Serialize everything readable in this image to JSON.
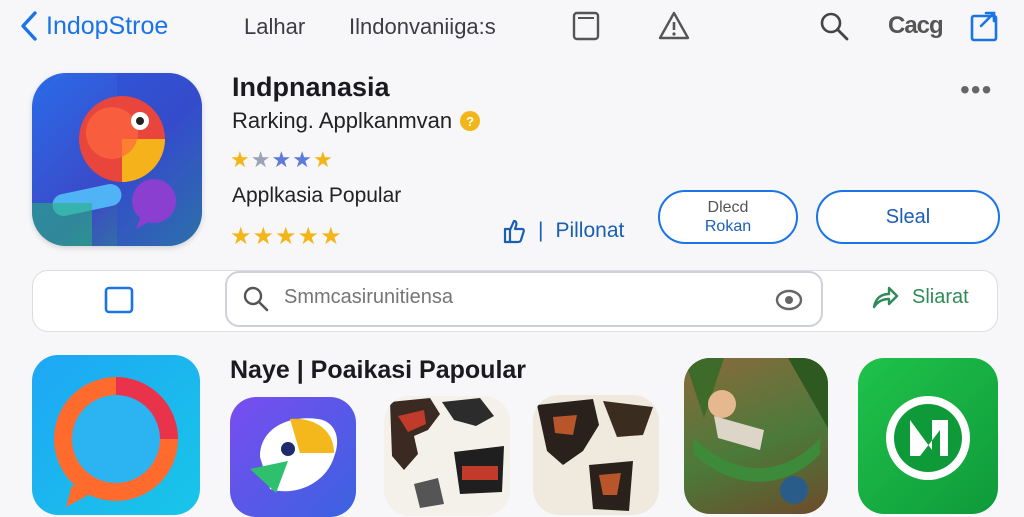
{
  "topbar": {
    "back_label": "IndopStroe",
    "tab1": "Lalhar",
    "tab2": "Ilndonvaniiga:s",
    "logo_text": "Cacg"
  },
  "app": {
    "name": "Indpnanasia",
    "subtitle": "Rarking. Applkanmvan",
    "badge": "?",
    "rating_stars": "★★★★★",
    "category": "Applkasia Popular",
    "stars_full": "★★★★★",
    "more": "•••"
  },
  "actions": {
    "thumb_label": "Pillonat",
    "separator": "|",
    "download_line1": "Dlecd",
    "download_line2": "Rokan",
    "main_label": "Sleal"
  },
  "search": {
    "placeholder": "Smmcasirunitiensa",
    "share_label": "Sliarat"
  },
  "section": {
    "title": "Naye | Poaikasi Papoular"
  },
  "colors": {
    "accent": "#1a73e8",
    "star": "#f2b619",
    "green": "#2e8b57"
  }
}
